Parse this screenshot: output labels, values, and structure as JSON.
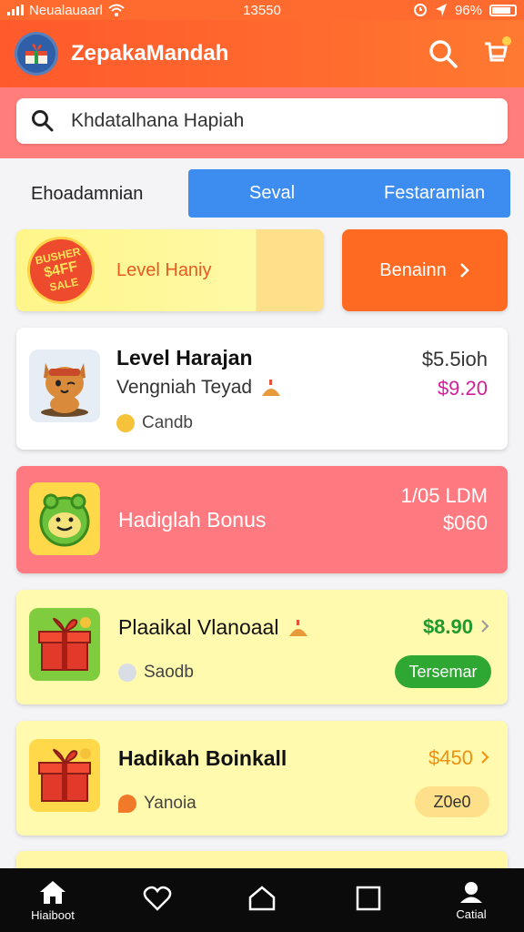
{
  "status_bar": {
    "carrier": "Neualauaarl",
    "time": "13550",
    "battery": "96%"
  },
  "header": {
    "title": "ZepakaMandah",
    "search_icon": "search-icon",
    "cart_icon": "cart-icon"
  },
  "search": {
    "placeholder": "Khdatalhana Hapiah"
  },
  "tabs": {
    "left_label": "Ehoadamnian",
    "pill_left": "Seval",
    "pill_right": "Festaramian"
  },
  "promo": {
    "badge_lines": [
      "BUSHER",
      "$4FF",
      "SALE"
    ],
    "title": "Level Haniy",
    "button_label": "Benainn"
  },
  "items": [
    {
      "title": "Level Harajan",
      "subtitle": "Vengniah Teyad",
      "meta": "Candb",
      "price_top": "$5.5ioh",
      "price": "$9.20"
    },
    {
      "title": "Hadiglah Bonus",
      "price_top": "1/05 LDM",
      "price": "$060"
    },
    {
      "title": "Plaaikal Vlanoaal",
      "meta": "Saodb",
      "price": "$8.90",
      "action": "Tersemar"
    },
    {
      "title": "Hadikah Boinkall",
      "meta": "Yanoia",
      "price": "$450",
      "action": "Z0e0"
    }
  ],
  "bottom_nav": [
    {
      "label": "Hiaiboot",
      "icon": "home-icon"
    },
    {
      "label": "",
      "icon": "heart-icon"
    },
    {
      "label": "",
      "icon": "house-outline-icon"
    },
    {
      "label": "",
      "icon": "square-icon"
    },
    {
      "label": "Catial",
      "icon": "profile-icon"
    }
  ],
  "colors": {
    "brand_orange": "#ff6a2e",
    "tab_blue": "#3d8cf0",
    "price_pink": "#d0209a",
    "price_green": "#1f9a2e",
    "price_orange": "#f09010"
  }
}
